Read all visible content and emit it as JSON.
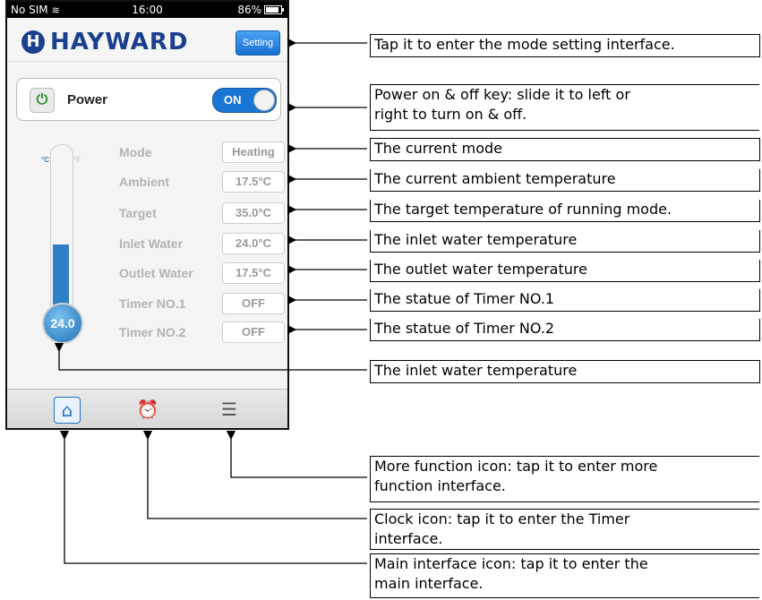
{
  "status": {
    "carrier": "No SIM",
    "time": "16:00",
    "battery": "86%"
  },
  "header": {
    "logo_mark": "H",
    "logo_text": "HAYWARD",
    "setting": "Setting"
  },
  "power": {
    "label": "Power",
    "toggle": "ON"
  },
  "thermometer": {
    "value": "24.0",
    "unit_c": "°C",
    "unit_f": "°F",
    "fill_fraction": 0.48
  },
  "params": [
    {
      "label": "Mode",
      "value": "Heating"
    },
    {
      "label": "Ambient",
      "value": "17.5°C"
    },
    {
      "label": "Target",
      "value": "35.0°C"
    },
    {
      "label": "Inlet Water",
      "value": "24.0°C"
    },
    {
      "label": "Outlet Water",
      "value": "17.5°C"
    },
    {
      "label": "Timer NO.1",
      "value": "OFF"
    },
    {
      "label": "Timer NO.2",
      "value": "OFF"
    }
  ],
  "tabbar": {
    "home_icon": "home-icon",
    "clock_icon": "alarm-clock-icon",
    "menu_icon": "list-icon"
  },
  "annotations": [
    "Tap it to enter the mode setting interface.",
    "Power on & off key: slide it to left or",
    "right to turn on & off.",
    "The current mode",
    "The current ambient temperature",
    "The target temperature of running mode.",
    "The inlet water temperature",
    "The outlet water temperature",
    "The statue of Timer NO.1",
    "The statue of Timer NO.2",
    "The inlet water temperature",
    "More function icon: tap it to enter more",
    "function interface.",
    "Clock icon: tap it to enter the Timer",
    "interface.",
    "Main interface icon: tap it to enter the",
    "main interface."
  ],
  "colors": {
    "brand": "#1b3f8f",
    "accent": "#1a76d4",
    "power_green": "#2f8c2f"
  }
}
